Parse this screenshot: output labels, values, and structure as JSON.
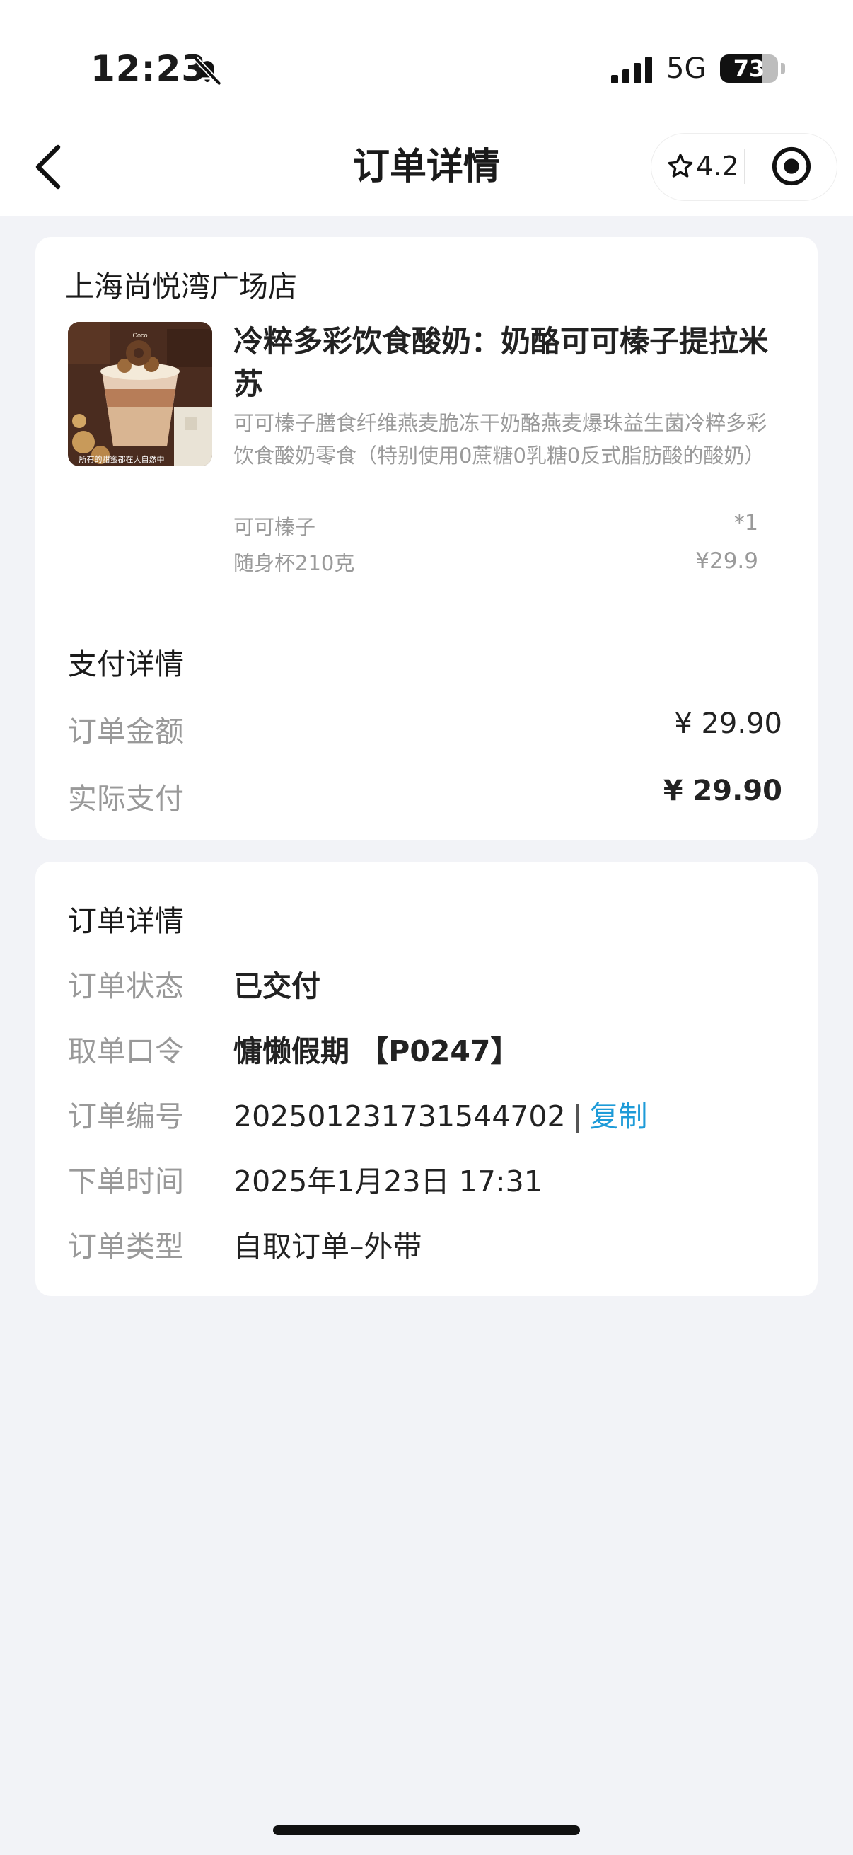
{
  "status_bar": {
    "time": "12:23",
    "network": "5G",
    "battery_percent": "73",
    "battery_level": 0.73,
    "signal_bars": 4,
    "silent_icon": "bell-slash-icon"
  },
  "nav": {
    "title": "订单详情",
    "back_icon": "chevron-left-icon",
    "rating": "4.2",
    "rating_icon": "star-outline-icon",
    "more_icon": "target-circle-icon"
  },
  "order_card": {
    "store_name": "上海尚悦湾广场店",
    "product": {
      "title": "冷粹多彩饮食酸奶：奶酪可可榛子提拉米苏",
      "description": "可可榛子膳食纤维燕麦脆冻干奶酪燕麦爆珠益生菌冷粹多彩饮食酸奶零食（特别使用0蔗糖0乳糖0反式脂肪酸的酸奶）",
      "spec_flavor": "可可榛子",
      "spec_size": "随身杯210克",
      "quantity": "*1",
      "price": "¥29.9",
      "image_caption": "所有的甜蜜都在大自然中",
      "image_brand": "Coco"
    },
    "payment": {
      "section_title": "支付详情",
      "order_amount_label": "订单金额",
      "order_amount": "¥ 29.90",
      "paid_label": "实际支付",
      "paid_amount": "¥ 29.90"
    }
  },
  "detail_card": {
    "section_title": "订单详情",
    "rows": [
      {
        "label": "订单状态",
        "value": "已交付"
      },
      {
        "label": "取单口令",
        "value": "慵懒假期 【P0247】"
      },
      {
        "label": "订单编号",
        "value": "202501231731544702"
      },
      {
        "label": "下单时间",
        "value": "2025年1月23日 17:31"
      },
      {
        "label": "订单类型",
        "value": "自取订单–外带"
      }
    ],
    "separator": "|",
    "copy_label": "复制"
  },
  "colors": {
    "background": "#f2f3f7",
    "card": "#ffffff",
    "muted_text": "#999999",
    "link": "#1e9bd8"
  }
}
